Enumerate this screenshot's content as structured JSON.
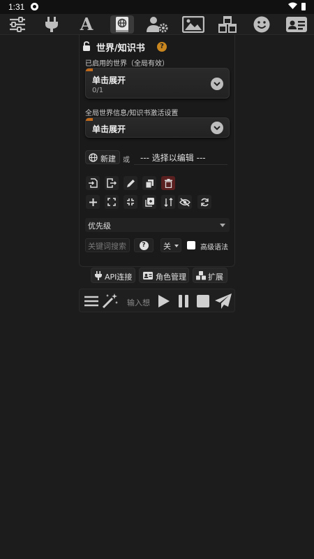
{
  "status_bar": {
    "time": "1:31"
  },
  "top_nav": {
    "items": [
      "sliders-icon",
      "plug-icon",
      "font-icon",
      "book-atlas-icon",
      "user-gear-icon",
      "image-icon",
      "cubes-icon",
      "smile-icon",
      "id-card-icon"
    ],
    "font_glyph": "A",
    "active": "book-atlas-icon"
  },
  "panel": {
    "title": "世界/知识书",
    "help_glyph": "?",
    "active_worlds_label": "已启用的世界（全局有效）",
    "active_worlds_drawer": {
      "title": "单击展开",
      "count": "0/1"
    },
    "global_settings_label": "全局世界信息/知识书激活设置",
    "global_settings_drawer": {
      "title": "单击展开"
    },
    "new_button": "新建",
    "or_text": "或",
    "select_placeholder": "--- 选择以编辑 ---",
    "sort_select": "优先级",
    "keyword_placeholder": "关键词搜索",
    "help_btn": "?",
    "case_select": "关",
    "advanced_syntax_label": "高级语法"
  },
  "toolbar_row1": [
    "import-icon",
    "export-icon",
    "rename-icon",
    "duplicate-icon",
    "delete-icon"
  ],
  "toolbar_row2": [
    "plus-icon",
    "expand-icon",
    "compress-icon",
    "backfill-icon",
    "sort-icon",
    "eye-slash-icon",
    "refresh-icon"
  ],
  "bottom_bar": {
    "api": "API连接",
    "characters": "角色管理",
    "extensions": "扩展"
  },
  "input_bar": {
    "placeholder": "输入想"
  },
  "colors": {
    "background": "#1c1c1c",
    "accent_orange": "#c9861e",
    "delete_red": "#5a1f1f"
  }
}
